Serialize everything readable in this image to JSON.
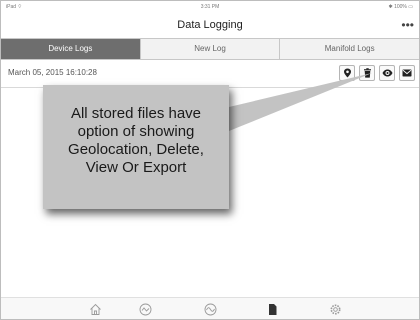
{
  "status_bar": {
    "carrier": "iPad ⌔",
    "time": "3:31 PM",
    "battery": "✱ 100% ▭"
  },
  "nav": {
    "title": "Data Logging",
    "more_label": "•••"
  },
  "tabs": [
    {
      "label": "Device Logs",
      "active": true
    },
    {
      "label": "New Log",
      "active": false
    },
    {
      "label": "Manifold Logs",
      "active": false
    }
  ],
  "log_entry": {
    "date": "March 05, 2015 16:10:28"
  },
  "action_icons": [
    "geolocation-icon",
    "delete-icon",
    "view-icon",
    "export-icon"
  ],
  "callout": {
    "text": "All stored files have option of showing Geolocation, Delete, View Or Export"
  },
  "bottom_tabs": [
    "home-icon",
    "gauge-icon",
    "chart-icon",
    "document-icon",
    "settings-icon"
  ],
  "colors": {
    "active_tab_bg": "#6e6e6e",
    "callout_bg": "#c3c3c3"
  }
}
